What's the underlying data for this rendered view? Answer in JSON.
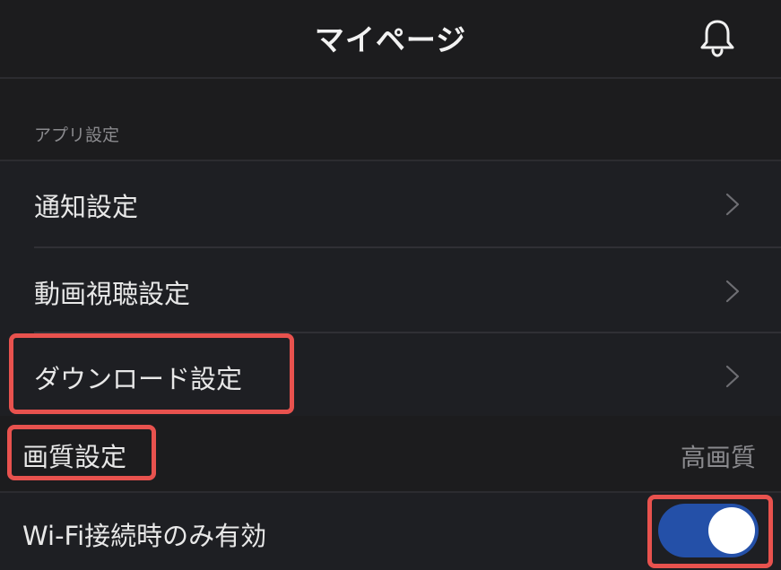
{
  "header": {
    "title": "マイページ",
    "notification_icon": "bell-icon"
  },
  "section": {
    "label": "アプリ設定"
  },
  "settings": {
    "items": [
      {
        "label": "通知設定",
        "icon": "chevron-right-icon"
      },
      {
        "label": "動画視聴設定",
        "icon": "chevron-right-icon"
      },
      {
        "label": "ダウンロード設定",
        "icon": "chevron-right-icon"
      }
    ]
  },
  "quality": {
    "label": "画質設定",
    "value": "高画質"
  },
  "wifi": {
    "label": "Wi-Fi接続時のみ有効",
    "enabled": true
  },
  "colors": {
    "background": "#1c1c1e",
    "toggle_on": "#2450a8",
    "highlight": "#e8524e",
    "secondary_text": "#8a8a8e"
  }
}
